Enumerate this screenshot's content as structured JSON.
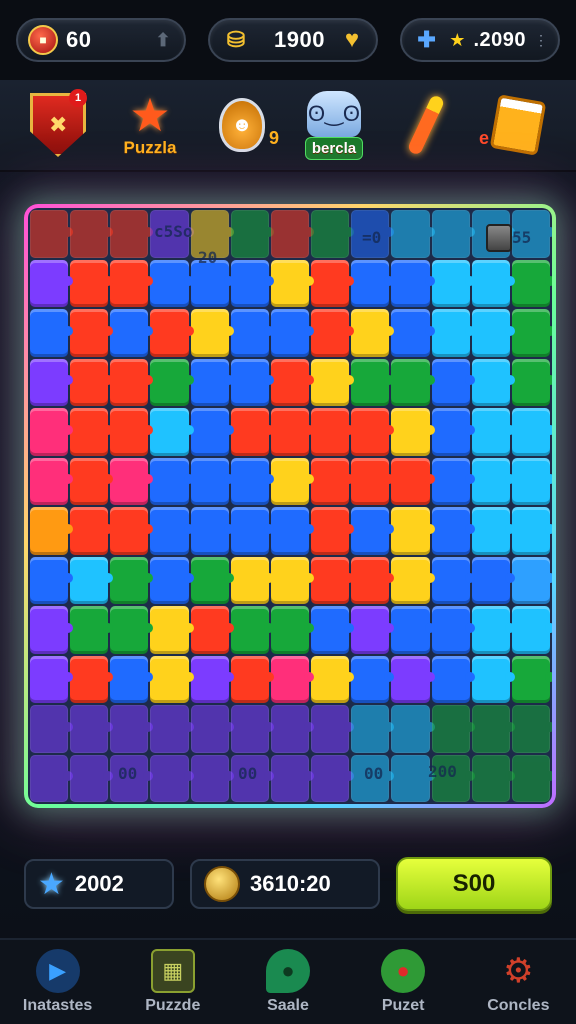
{
  "topbar": {
    "lives": {
      "value": "60",
      "icon": "chest-icon",
      "side_icon": "arrow-up-icon"
    },
    "coins": {
      "value": "1900",
      "icon": "coins-icon",
      "side_icon": "gold-heart-icon"
    },
    "stars": {
      "value": ".2090",
      "icon": "puzzle-piece-icon"
    }
  },
  "tools": [
    {
      "name": "shield",
      "badge": "1",
      "icon": "shield-icon"
    },
    {
      "name": "puzzle",
      "label": "Puzzla",
      "icon": "star-icon"
    },
    {
      "name": "potion",
      "count": "9",
      "icon": "potion-icon"
    },
    {
      "name": "mascot",
      "label": "bercla",
      "icon": "mascot-icon"
    },
    {
      "name": "wand",
      "icon": "wand-icon"
    },
    {
      "name": "drink",
      "count": "e",
      "icon": "mug-icon"
    }
  ],
  "board": {
    "edge_labels": [
      "c5So",
      "20",
      "=0",
      "55",
      "00",
      "00",
      "00",
      "200"
    ],
    "colors": {
      "R": "#ff3a20",
      "B": "#1f6bff",
      "C": "#1fc2ff",
      "Y": "#ffd21c",
      "G": "#17a83a",
      "P": "#7c3cff",
      "K": "#ff2f7a",
      "T": "#2ea0ff",
      "O": "#ff9a12"
    },
    "rows": [
      "RRRPYGRGBCCCC",
      "PRRBBBYRBBCCG",
      "BRBRYBBRYBCCG",
      "PRRGBBRYGGBCG",
      "KRRCBRRRRYBCC",
      "KRKBBBYRRRBCC",
      "ORRBBBBRBYBCC",
      "BCGBGYYRRYBBT",
      "PGGYRGGBPBBCC",
      "PRBYPRKYBPBCG",
      "PPPPPPPPCCGGG",
      "PPPPPPPPCCGGG"
    ]
  },
  "stats": {
    "stars": {
      "value": "2002",
      "icon": "blue-star-icon"
    },
    "gold": {
      "value": "3610:20",
      "icon": "gold-coin-icon"
    },
    "go_button": "S00"
  },
  "nav": [
    {
      "label": "Inatastes",
      "icon": "play-icon",
      "color": "#2a8cff"
    },
    {
      "label": "Puzzde",
      "icon": "puzzle-board-icon",
      "color": "#8aa030"
    },
    {
      "label": "Saale",
      "icon": "map-icon",
      "color": "#1a8a50"
    },
    {
      "label": "Puzet",
      "icon": "apple-icon",
      "color": "#3cb040"
    },
    {
      "label": "Concles",
      "icon": "gear-icon",
      "color": "#d0402a"
    }
  ]
}
